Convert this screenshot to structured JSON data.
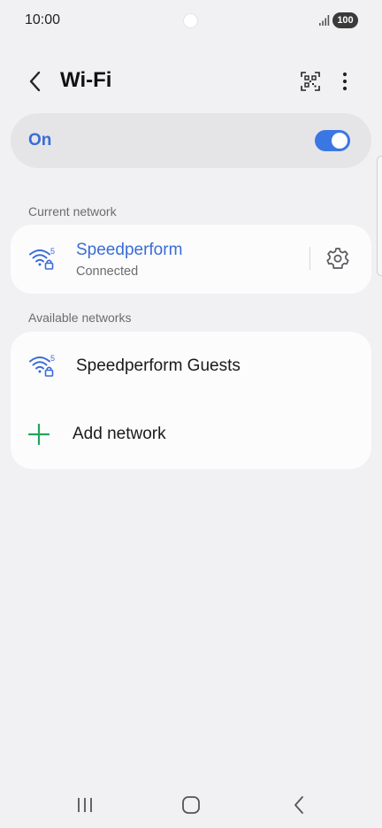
{
  "status_bar": {
    "time": "10:00",
    "battery": "100"
  },
  "header": {
    "title": "Wi-Fi"
  },
  "master_toggle": {
    "label": "On",
    "state": true
  },
  "current_network": {
    "section_label": "Current network",
    "name": "Speedperform",
    "status": "Connected",
    "band": "5"
  },
  "available_networks": {
    "section_label": "Available networks",
    "items": [
      {
        "name": "Speedperform Guests",
        "band": "5"
      }
    ],
    "add_label": "Add network"
  },
  "colors": {
    "accent": "#3a6cd6",
    "switch_on": "#3b77e3",
    "add_plus": "#22a45a",
    "background": "#f1f1f3",
    "card": "#fcfcfd"
  },
  "icons": {
    "back": "chevron-left-icon",
    "qr": "qr-code-icon",
    "more": "more-vertical-icon",
    "wifi": "wifi-5ghz-locked-icon",
    "settings": "gear-icon",
    "add": "plus-icon"
  }
}
